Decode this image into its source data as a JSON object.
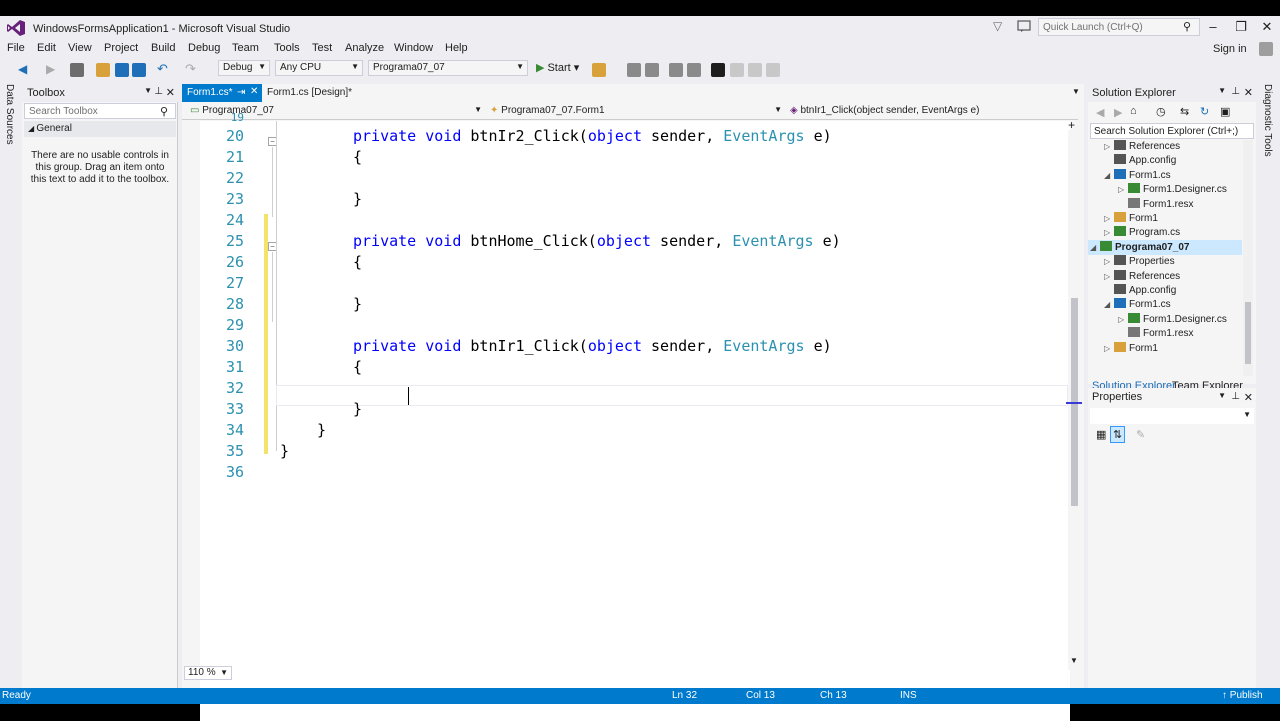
{
  "window": {
    "title": "WindowsFormsApplication1 - Microsoft Visual Studio",
    "quick_launch_placeholder": "Quick Launch (Ctrl+Q)",
    "sign_in": "Sign in"
  },
  "menu": [
    "File",
    "Edit",
    "View",
    "Project",
    "Build",
    "Debug",
    "Team",
    "Tools",
    "Test",
    "Analyze",
    "Window",
    "Help"
  ],
  "toolbar": {
    "config": "Debug",
    "platform": "Any CPU",
    "startup_project": "Programa07_07",
    "start_label": "Start"
  },
  "left_tabs": {
    "data_sources": "Data Sources",
    "toolbox": "Toolbox"
  },
  "toolbox": {
    "title": "Toolbox",
    "search_placeholder": "Search Toolbox",
    "group": "General",
    "empty_message": "There are no usable controls in this group. Drag an item onto this text to add it to the toolbox."
  },
  "editor": {
    "tabs": [
      {
        "label": "Form1.cs*",
        "active": true
      },
      {
        "label": "Form1.cs [Design]*",
        "active": false
      }
    ],
    "nav": {
      "project": "Programa07_07",
      "type": "Programa07_07.Form1",
      "member": "btnIr1_Click(object sender, EventArgs e)"
    },
    "zoom": "110 %",
    "lines": [
      {
        "n": "20",
        "code": "private void btnIr2_Click(object sender, EventArgs e)"
      },
      {
        "n": "21",
        "code": "{"
      },
      {
        "n": "22",
        "code": ""
      },
      {
        "n": "23",
        "code": "}"
      },
      {
        "n": "24",
        "code": ""
      },
      {
        "n": "25",
        "code": "private void btnHome_Click(object sender, EventArgs e)"
      },
      {
        "n": "26",
        "code": "{"
      },
      {
        "n": "27",
        "code": ""
      },
      {
        "n": "28",
        "code": "}"
      },
      {
        "n": "29",
        "code": ""
      },
      {
        "n": "30",
        "code": "private void btnIr1_Click(object sender, EventArgs e)"
      },
      {
        "n": "31",
        "code": "{"
      },
      {
        "n": "32",
        "code": ""
      },
      {
        "n": "33",
        "code": "}"
      },
      {
        "n": "34",
        "code": "}"
      },
      {
        "n": "35",
        "code": "}"
      },
      {
        "n": "36",
        "code": ""
      }
    ]
  },
  "solution_explorer": {
    "title": "Solution Explorer",
    "search_placeholder": "Search Solution Explorer (Ctrl+;)",
    "items": [
      {
        "label": "References",
        "icon": "references-icon"
      },
      {
        "label": "App.config",
        "icon": "config-icon"
      },
      {
        "label": "Form1.cs",
        "icon": "form-icon"
      },
      {
        "label": "Form1.Designer.cs",
        "icon": "csharp-icon"
      },
      {
        "label": "Form1.resx",
        "icon": "resx-icon"
      },
      {
        "label": "Form1",
        "icon": "class-icon"
      },
      {
        "label": "Program.cs",
        "icon": "csharp-icon"
      },
      {
        "label": "Programa07_07",
        "icon": "project-icon",
        "selected": true
      },
      {
        "label": "Properties",
        "icon": "wrench-icon"
      },
      {
        "label": "References",
        "icon": "references-icon"
      },
      {
        "label": "App.config",
        "icon": "config-icon"
      },
      {
        "label": "Form1.cs",
        "icon": "form-icon"
      },
      {
        "label": "Form1.Designer.cs",
        "icon": "csharp-icon"
      },
      {
        "label": "Form1.resx",
        "icon": "resx-icon"
      },
      {
        "label": "Form1",
        "icon": "class-icon"
      }
    ],
    "tabs": [
      "Solution Explorer",
      "Team Explorer"
    ]
  },
  "properties": {
    "title": "Properties"
  },
  "right_tab": "Diagnostic Tools",
  "status": {
    "ready": "Ready",
    "ln": "Ln 32",
    "col": "Col 13",
    "ch": "Ch 13",
    "mode": "INS",
    "publish": "Publish"
  },
  "colors": {
    "accent": "#007acc",
    "keyword": "#0000ff",
    "type": "#2b91af",
    "line_number": "#2b91af",
    "change_bar": "#f3e36b"
  }
}
